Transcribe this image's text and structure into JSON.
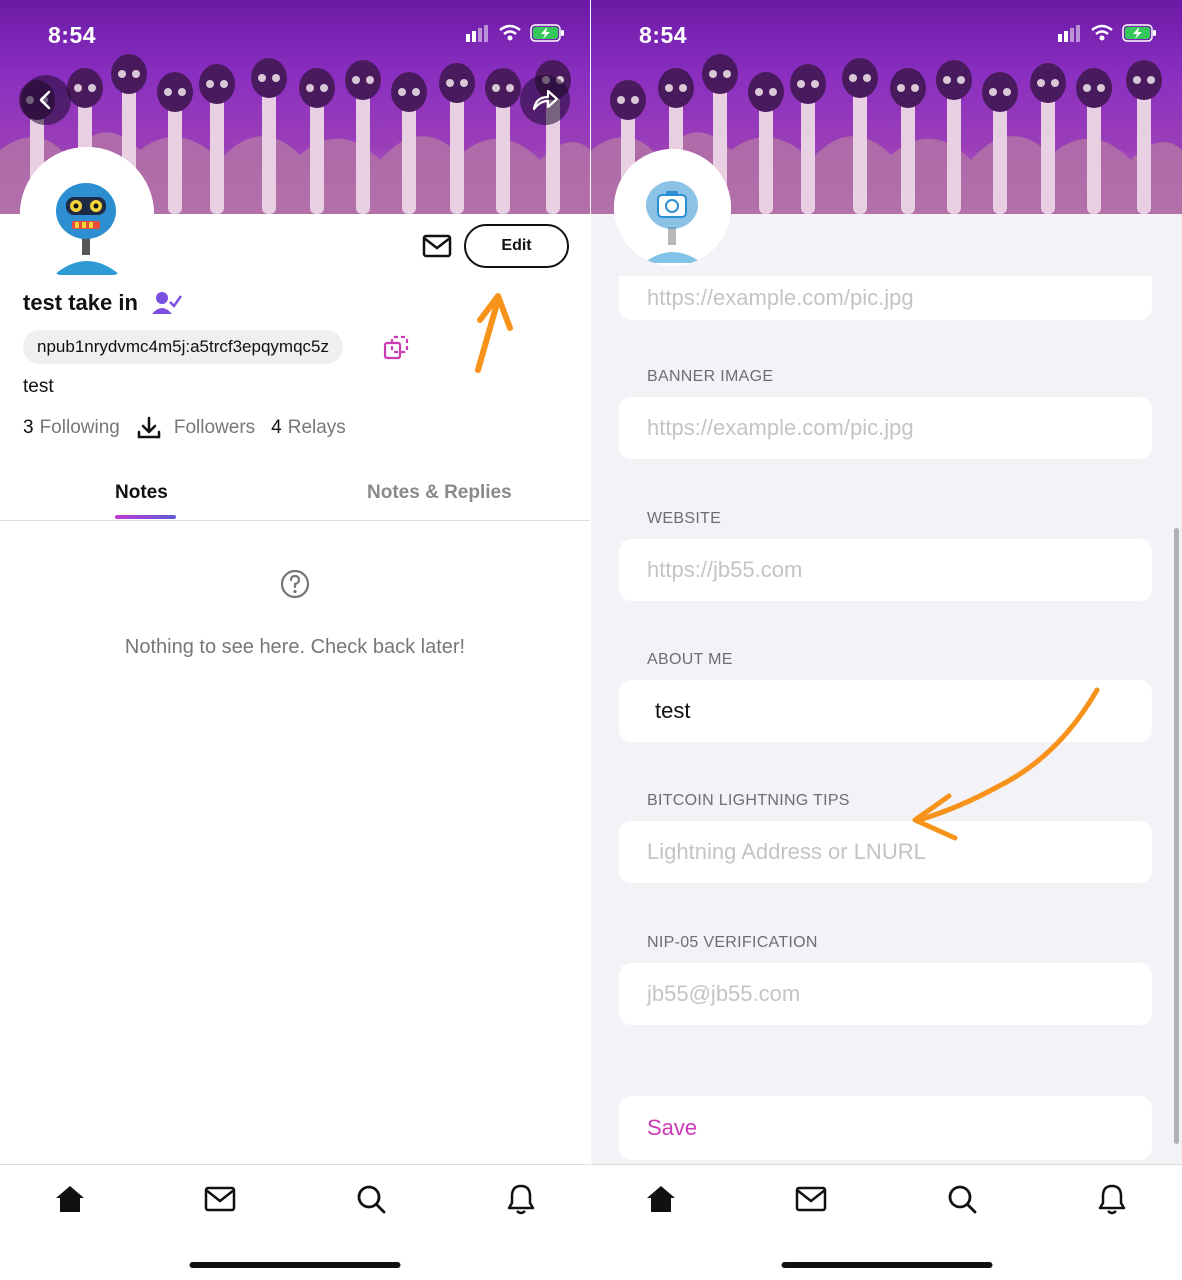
{
  "status_bar": {
    "time": "8:54"
  },
  "profile": {
    "display_name": "test take in",
    "npub": "npub1nrydvmc4m5j:a5trcf3epqymqc5z",
    "about": "test",
    "edit_label": "Edit",
    "stats": {
      "following_count": "3",
      "following_label": "Following",
      "followers_label": "Followers",
      "relays_count": "4",
      "relays_label": "Relays"
    },
    "tabs": [
      "Notes",
      "Notes & Replies"
    ],
    "empty_message": "Nothing to see here. Check back later!"
  },
  "edit_form": {
    "fields": [
      {
        "label": "",
        "placeholder": "https://example.com/pic.jpg",
        "value": ""
      },
      {
        "label": "BANNER IMAGE",
        "placeholder": "https://example.com/pic.jpg",
        "value": ""
      },
      {
        "label": "WEBSITE",
        "placeholder": "https://jb55.com",
        "value": ""
      },
      {
        "label": "ABOUT ME",
        "placeholder": "",
        "value": "test"
      },
      {
        "label": "BITCOIN LIGHTNING TIPS",
        "placeholder": "Lightning Address or LNURL",
        "value": ""
      },
      {
        "label": "NIP-05 VERIFICATION",
        "placeholder": "jb55@jb55.com",
        "value": ""
      }
    ],
    "save_label": "Save"
  },
  "tab_bar": [
    "home-icon",
    "mail-icon",
    "search-icon",
    "bell-icon"
  ],
  "colors": {
    "accent_pink": "#cc3ab6",
    "verify_purple": "#7b4fe0",
    "annotation_orange": "#f7931a",
    "banner_purple": "#7d26b4",
    "form_background": "#f2f2f7"
  }
}
